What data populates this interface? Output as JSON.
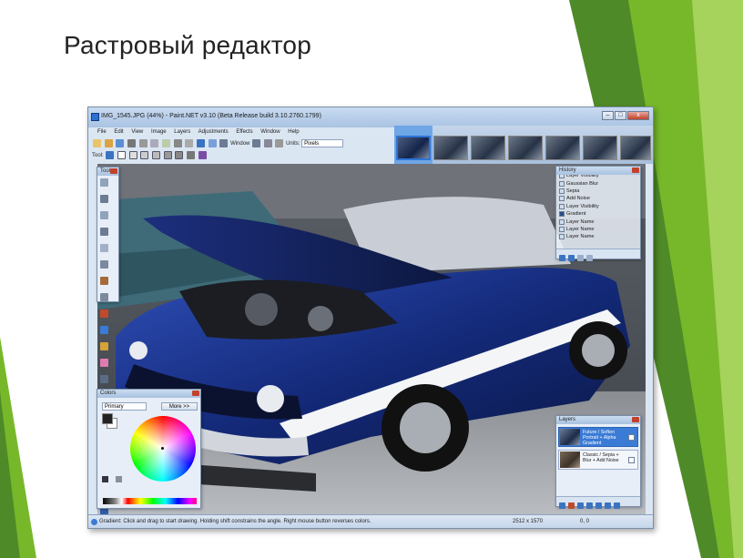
{
  "slide": {
    "title": "Растровый редактор"
  },
  "colors": {
    "green_dark": "#4f8a28",
    "green": "#77b82a",
    "green_light": "#a6d35b",
    "accent": "#3a7bd5"
  },
  "window": {
    "title": "IMG_1545.JPG (44%) - Paint.NET v3.10 (Beta Release build 3.10.2760.1799)",
    "controls": {
      "minimize": "–",
      "maximize": "□",
      "close": "x"
    }
  },
  "menu": [
    "File",
    "Edit",
    "View",
    "Image",
    "Layers",
    "Adjustments",
    "Effects",
    "Window",
    "Help"
  ],
  "toolbar": {
    "zoom_label": "Window",
    "units_label": "Units:",
    "units_value": "Pixels",
    "tool_label": "Tool:"
  },
  "tools_panel": {
    "title": "Tools"
  },
  "history_panel": {
    "title": "History",
    "items": [
      "Layer Visibility",
      "Gaussian Blur",
      "Sepia",
      "Add Noise",
      "Layer Visibility",
      "Gradient",
      "Layer Name",
      "Layer Name",
      "Layer Name"
    ]
  },
  "colors_panel": {
    "title": "Colors",
    "mode": "Primary",
    "more_button": "More >>"
  },
  "layers_panel": {
    "title": "Layers",
    "layers": [
      {
        "name": "Future / Soften Portrait + Alpha Gradient",
        "visible": true
      },
      {
        "name": "Classic / Sepia + Blur + Add Noise",
        "visible": true
      }
    ]
  },
  "status": {
    "message": "Gradient: Click and drag to start drawing. Holding shift constrains the angle. Right mouse button reverses colors.",
    "dimensions": "2512 x 1570",
    "position": "0, 0"
  }
}
